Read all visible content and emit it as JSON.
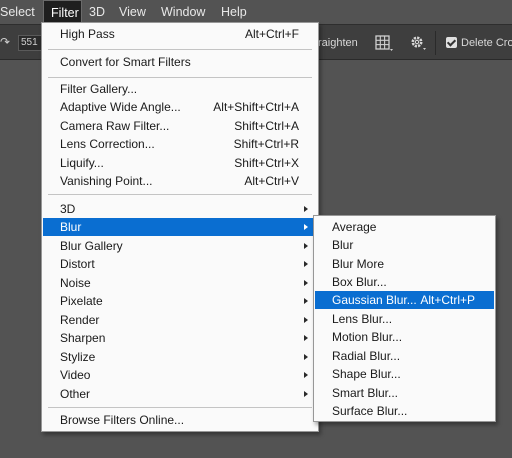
{
  "menubar": {
    "items": [
      "Select",
      "Filter",
      "3D",
      "View",
      "Window",
      "Help"
    ]
  },
  "options_bar": {
    "field_value": "551 p",
    "straighten_label": "raighten",
    "delete_crop_label": "Delete Crop",
    "delete_crop_checked": true
  },
  "filter_menu": {
    "items": [
      {
        "label": "High Pass",
        "shortcut": "Alt+Ctrl+F"
      },
      {
        "label": "Convert for Smart Filters",
        "shortcut": ""
      },
      {
        "label": "Filter Gallery...",
        "shortcut": ""
      },
      {
        "label": "Adaptive Wide Angle...",
        "shortcut": "Alt+Shift+Ctrl+A"
      },
      {
        "label": "Camera Raw Filter...",
        "shortcut": "Shift+Ctrl+A"
      },
      {
        "label": "Lens Correction...",
        "shortcut": "Shift+Ctrl+R"
      },
      {
        "label": "Liquify...",
        "shortcut": "Shift+Ctrl+X"
      },
      {
        "label": "Vanishing Point...",
        "shortcut": "Alt+Ctrl+V"
      },
      {
        "label": "3D",
        "submenu": true
      },
      {
        "label": "Blur",
        "submenu": true,
        "highlighted": true
      },
      {
        "label": "Blur Gallery",
        "submenu": true
      },
      {
        "label": "Distort",
        "submenu": true
      },
      {
        "label": "Noise",
        "submenu": true
      },
      {
        "label": "Pixelate",
        "submenu": true
      },
      {
        "label": "Render",
        "submenu": true
      },
      {
        "label": "Sharpen",
        "submenu": true
      },
      {
        "label": "Stylize",
        "submenu": true
      },
      {
        "label": "Video",
        "submenu": true
      },
      {
        "label": "Other",
        "submenu": true
      },
      {
        "label": "Browse Filters Online...",
        "shortcut": ""
      }
    ]
  },
  "blur_menu": {
    "items": [
      {
        "label": "Average",
        "shortcut": ""
      },
      {
        "label": "Blur",
        "shortcut": ""
      },
      {
        "label": "Blur More",
        "shortcut": ""
      },
      {
        "label": "Box Blur...",
        "shortcut": ""
      },
      {
        "label": "Gaussian Blur...",
        "shortcut": "Alt+Ctrl+P",
        "highlighted": true
      },
      {
        "label": "Lens Blur...",
        "shortcut": ""
      },
      {
        "label": "Motion Blur...",
        "shortcut": ""
      },
      {
        "label": "Radial Blur...",
        "shortcut": ""
      },
      {
        "label": "Shape Blur...",
        "shortcut": ""
      },
      {
        "label": "Smart Blur...",
        "shortcut": ""
      },
      {
        "label": "Surface Blur...",
        "shortcut": ""
      }
    ]
  },
  "colors": {
    "highlight": "#0a6ed1",
    "menu_bg": "#fafafa",
    "app_bg": "#535353",
    "options_bar_bg": "#3e3e3e"
  }
}
